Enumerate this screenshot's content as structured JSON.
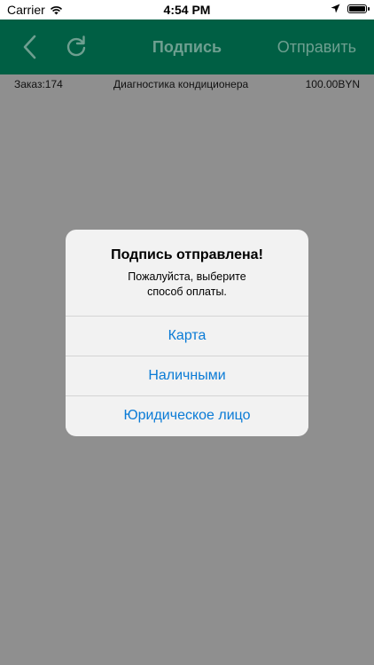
{
  "status_bar": {
    "carrier": "Carrier",
    "time": "4:54 PM"
  },
  "nav": {
    "title": "Подпись",
    "send_label": "Отправить",
    "back_icon": "chevron-left-icon",
    "refresh_icon": "refresh-icon"
  },
  "order": {
    "number": "Заказ:174",
    "service": "Диагностика кондиционера",
    "price": "100.00BYN"
  },
  "alert": {
    "title": "Подпись отправлена!",
    "message_line1": "Пожалуйста, выберите",
    "message_line2": "способ оплаты.",
    "actions": [
      {
        "label": "Карта"
      },
      {
        "label": "Наличными"
      },
      {
        "label": "Юридическое лицо"
      }
    ]
  },
  "colors": {
    "nav_background": "#005f44",
    "nav_text": "#6e9f90",
    "dim_background": "#8f8f8f",
    "action_blue": "#0a7bd6"
  }
}
